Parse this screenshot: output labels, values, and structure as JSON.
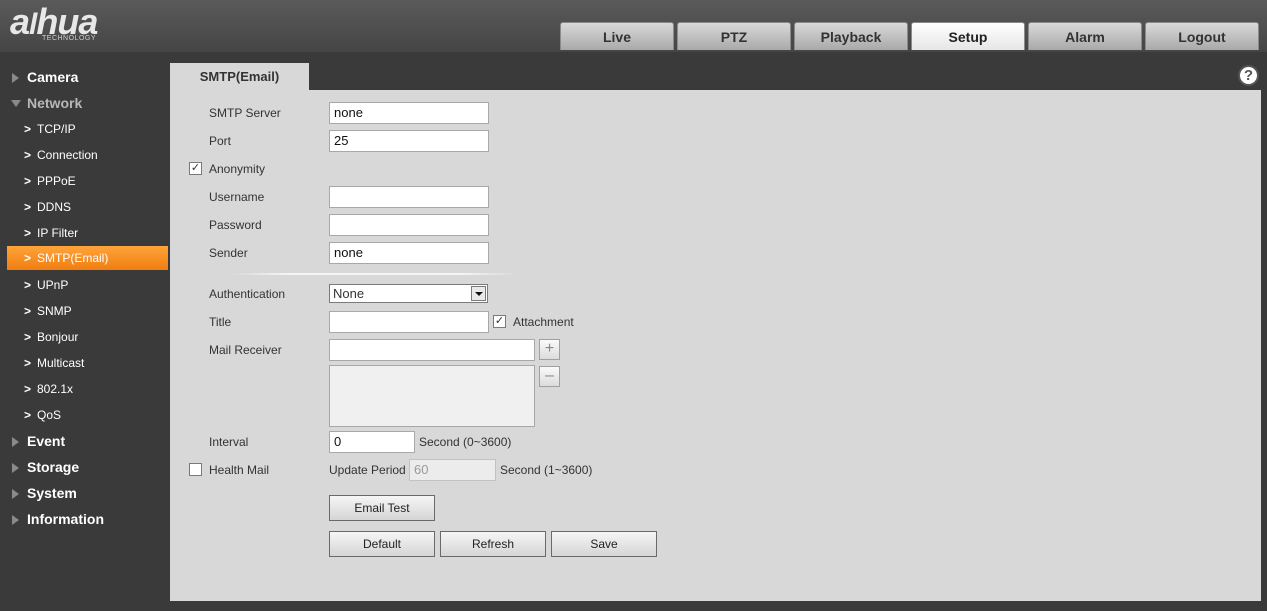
{
  "brand": {
    "logo": "alhua",
    "logo_sub": "TECHNOLOGY"
  },
  "nav": {
    "tabs": [
      {
        "label": "Live"
      },
      {
        "label": "PTZ"
      },
      {
        "label": "Playback"
      },
      {
        "label": "Setup",
        "active": true
      },
      {
        "label": "Alarm"
      },
      {
        "label": "Logout"
      }
    ]
  },
  "sidebar": {
    "camera": "Camera",
    "network": "Network",
    "network_items": [
      "TCP/IP",
      "Connection",
      "PPPoE",
      "DDNS",
      "IP Filter",
      "SMTP(Email)",
      "UPnP",
      "SNMP",
      "Bonjour",
      "Multicast",
      "802.1x",
      "QoS"
    ],
    "active_item": "SMTP(Email)",
    "event": "Event",
    "storage": "Storage",
    "system": "System",
    "information": "Information"
  },
  "page": {
    "tab_title": "SMTP(Email)",
    "help_icon": "question-circle-icon"
  },
  "form": {
    "smtp_server": {
      "label": "SMTP Server",
      "value": "none"
    },
    "port": {
      "label": "Port",
      "value": "25"
    },
    "anonymity": {
      "label": "Anonymity",
      "checked": true
    },
    "username": {
      "label": "Username",
      "value": ""
    },
    "password": {
      "label": "Password",
      "value": ""
    },
    "sender": {
      "label": "Sender",
      "value": "none"
    },
    "authentication": {
      "label": "Authentication",
      "value": "None"
    },
    "title": {
      "label": "Title",
      "value": ""
    },
    "attachment": {
      "label": "Attachment",
      "checked": true
    },
    "mail_receiver": {
      "label": "Mail Receiver",
      "value": ""
    },
    "interval": {
      "label": "Interval",
      "value": "0",
      "unit": "Second (0~3600)"
    },
    "health_mail": {
      "label": "Health Mail",
      "checked": false
    },
    "update_period": {
      "label": "Update Period",
      "value": "60",
      "unit": "Second (1~3600)"
    }
  },
  "buttons": {
    "email_test": "Email Test",
    "default": "Default",
    "refresh": "Refresh",
    "save": "Save"
  }
}
